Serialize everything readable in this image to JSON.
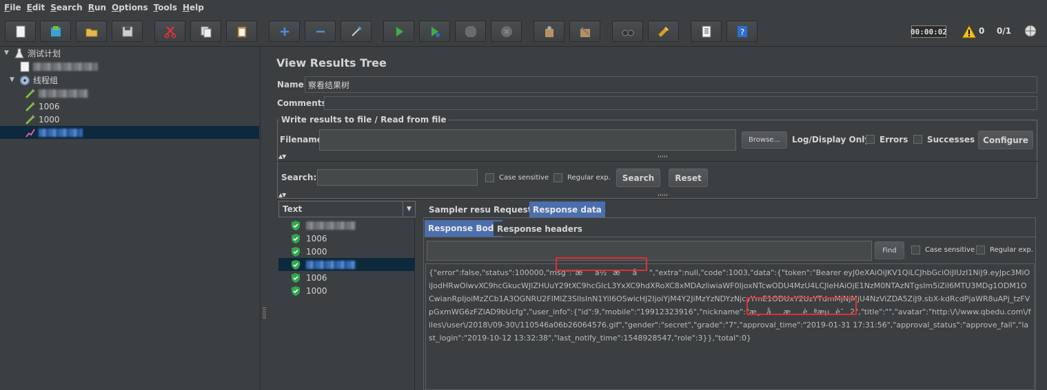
{
  "menu": [
    "File",
    "Edit",
    "Search",
    "Run",
    "Options",
    "Tools",
    "Help"
  ],
  "toolbar": {
    "buttons": [
      "new-icon",
      "templates-icon",
      "open-icon",
      "save-icon",
      "cut-icon",
      "copy-icon",
      "paste-icon",
      "expand-icon",
      "collapse-icon",
      "toggle-icon",
      "start-icon",
      "start-no-pause-icon",
      "stop-icon",
      "shutdown-icon",
      "clear-icon",
      "clear-all-icon",
      "search-icon",
      "reset-search-icon",
      "function-helper-icon",
      "help-icon"
    ],
    "timer": "00:00:02",
    "warnings": "0",
    "threads": "0/1"
  },
  "tree": {
    "plan": "测试计划",
    "thread_group": "线程组",
    "items": [
      "1006",
      "1000"
    ]
  },
  "panel": {
    "title": "View Results Tree",
    "name_label": "Name:",
    "name_value": "察看结果树",
    "comments_label": "Comments:",
    "write_results_title": "Write results to file / Read from file",
    "filename_label": "Filename",
    "browse": "Browse...",
    "log_display_only": "Log/Display Only:",
    "errors": "Errors",
    "successes": "Successes",
    "configure": "Configure",
    "search_label": "Search:",
    "case_sensitive": "Case sensitive",
    "regular_exp": "Regular exp.",
    "search_button": "Search",
    "reset_button": "Reset"
  },
  "results": {
    "renderer": "Text",
    "rows": [
      "1006",
      "1000",
      "1006",
      "1000"
    ]
  },
  "tabs": [
    "Sampler result",
    "Request",
    "Response data"
  ],
  "subtabs": [
    "Response Body",
    "Response headers"
  ],
  "response": {
    "find": "Find",
    "case_sensitive": "Case sensitive",
    "regular_exp": "Regular exp.",
    "body": "{\"error\":false,\"status\":100000,\"msg\":\"æä½æå\",\"extra\":null,\"code\":1003,\"data\":{\"token\":\"Bearer eyJ0eXAiOiJKV1QiLCJhbGciOiJIUzI1NiJ9.eyJpc3MiOiJodHRwOlwvXC9hcGkucWJlZHUuY29tXC9hcGlcL3YxXC9hdXRoXC8xMDAzliwiaWF0IjoxNTcwODU4MzU4LCJleHAiOjE1NzM0NTAzNTgsIm5iZiI6MTU3MDg1ODM1OCwianRpIjoiMzZCb1A3OGNRU2FIMlZ3SlIsInN1YiI6OSwicHJ2IjoiYjM4Y2JiMzYzNDYzNjcyYmE1ODUxY2UzYTdmMjNjMjU4NzViZDA5ZiJ9.sbX-kdRcdPjaWR8uAPj_tzFVpGxmWG6zFZlAD9bUcfg\",\"user_info\":{\"id\":9,\"mobile\":\"19912323916\",\"nickname\":\"æ¸åæèªæµè¯2\",\"title\":\"\",\"avatar\":\"http:\\/\\/www.qbedu.com\\/files\\/user\\/2018\\/09-30\\/110546a06b26064576.gif\",\"gender\":\"secret\",\"grade\":\"7\",\"approval_time\":\"2019-01-31 17:31:56\",\"approval_status\":\"approve_fail\",\"last_login\":\"2019-10-12 13:32:38\",\"last_notify_time\":1548928547,\"role\":3}},\"total\":0}"
  }
}
